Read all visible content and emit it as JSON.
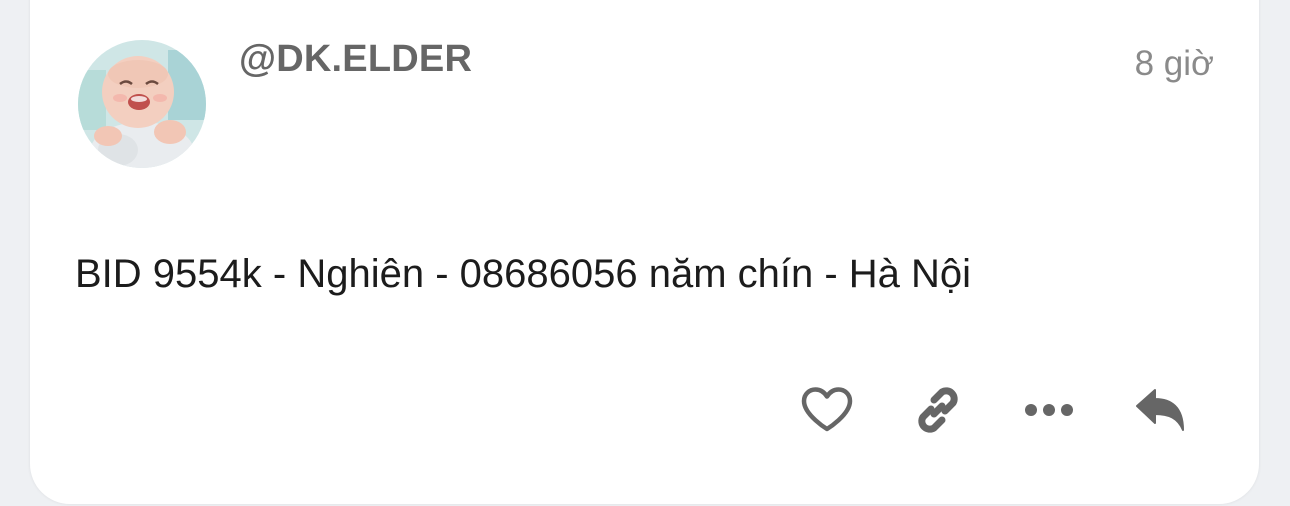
{
  "post": {
    "username": "@DK.ELDER",
    "time": "8 giờ",
    "text": "BID 9554k - Nghiên - 08686056 năm chín - Hà Nội"
  },
  "actions": [
    {
      "icon": "heart-icon"
    },
    {
      "icon": "link-icon"
    },
    {
      "icon": "more-icon"
    },
    {
      "icon": "reply-icon"
    }
  ],
  "colors": {
    "username": "#666666",
    "time": "#8a8a8a",
    "text": "#1c1c1c",
    "icon": "#666666",
    "background": "#eef0f3",
    "card": "#ffffff"
  }
}
